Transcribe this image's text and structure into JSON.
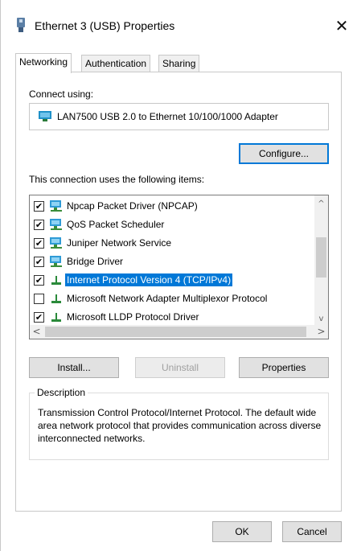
{
  "window": {
    "title": "Ethernet 3 (USB) Properties",
    "close_glyph": "✕"
  },
  "tabs": [
    {
      "label": "Networking",
      "active": true
    },
    {
      "label": "Authentication",
      "active": false
    },
    {
      "label": "Sharing",
      "active": false
    }
  ],
  "connect": {
    "label": "Connect using:",
    "adapter": "LAN7500 USB 2.0 to Ethernet 10/100/1000 Adapter",
    "configure_label": "Configure..."
  },
  "items": {
    "label": "This connection uses the following items:",
    "rows": [
      {
        "label": "Npcap Packet Driver (NPCAP)",
        "checked": true,
        "icon": "network-client-icon",
        "selected": false
      },
      {
        "label": "QoS Packet Scheduler",
        "checked": true,
        "icon": "network-client-icon",
        "selected": false
      },
      {
        "label": "Juniper Network Service",
        "checked": true,
        "icon": "network-client-icon",
        "selected": false
      },
      {
        "label": "Bridge Driver",
        "checked": true,
        "icon": "network-client-icon",
        "selected": false
      },
      {
        "label": "Internet Protocol Version 4 (TCP/IPv4)",
        "checked": true,
        "icon": "protocol-icon",
        "selected": true
      },
      {
        "label": "Microsoft Network Adapter Multiplexor Protocol",
        "checked": false,
        "icon": "protocol-icon",
        "selected": false
      },
      {
        "label": "Microsoft LLDP Protocol Driver",
        "checked": true,
        "icon": "protocol-icon",
        "selected": false
      }
    ],
    "scroll_up": "^",
    "scroll_down": "v",
    "scroll_left": "<",
    "scroll_right": ">"
  },
  "actions": {
    "install_label": "Install...",
    "uninstall_label": "Uninstall",
    "properties_label": "Properties"
  },
  "description": {
    "legend": "Description",
    "text": "Transmission Control Protocol/Internet Protocol. The default wide area network protocol that provides communication across diverse interconnected networks."
  },
  "footer": {
    "ok_label": "OK",
    "cancel_label": "Cancel"
  },
  "colors": {
    "accent": "#0078d7",
    "button_face": "#e1e1e1",
    "border": "#c8c8c8"
  }
}
